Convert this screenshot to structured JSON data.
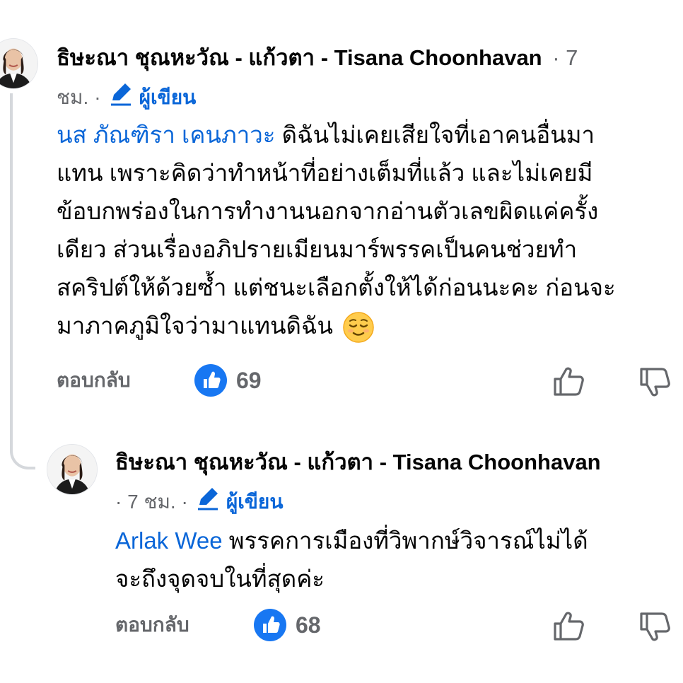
{
  "comments": [
    {
      "author": "ธิษะณา ชุณหะวัณ - แก้วตา - Tisana Choonhavan",
      "time_head": "· 7",
      "time_tail": "ชม.",
      "role_label": "ผู้เขียน",
      "mention": "นส ภัณฑิรา เคนภาวะ",
      "lines": [
        " ดิฉันไม่เคยเสียใจที่เอาคนอื่นมา",
        "แทน เพราะคิดว่าทำหน้าที่อย่างเต็มที่แล้ว และไม่เคยมี",
        "ข้อบกพร่องในการทำงานนอกจากอ่านตัวเลขผิดแค่ครั้ง",
        "เดียว ส่วนเรื่องอภิปรายเมียนมาร์พรรคเป็นคนช่วยทำ",
        "สคริปต์ให้ด้วยซ้ำ แต่ชนะเลือกตั้งให้ได้ก่อนนะคะ ก่อนจะ",
        "มาภาคภูมิใจว่ามาแทนดิฉัน"
      ],
      "emoji": "relieved-face",
      "reply_label": "ตอบกลับ",
      "like_count": "69"
    },
    {
      "author": "ธิษะณา ชุณหะวัณ - แก้วตา - Tisana Choonhavan",
      "time": "· 7 ชม. ·",
      "role_label": "ผู้เขียน",
      "mention": "Arlak Wee",
      "lines": [
        " พรรคการเมืองที่วิพากษ์วิจารณ์ไม่ได้",
        "จะถึงจุดจบในที่สุดค่ะ"
      ],
      "reply_label": "ตอบกลับ",
      "like_count": "68"
    }
  ],
  "colors": {
    "accent": "#0a66d8",
    "like_badge": "#1877f2",
    "secondary_text": "#65676b",
    "primary_text": "#050505",
    "thread_line": "#d5d8dc"
  },
  "icons": {
    "role": "pencil-icon",
    "like_badge": "thumbs-up-icon",
    "upvote": "thumbs-up-outline-icon",
    "downvote": "thumbs-down-outline-icon"
  }
}
